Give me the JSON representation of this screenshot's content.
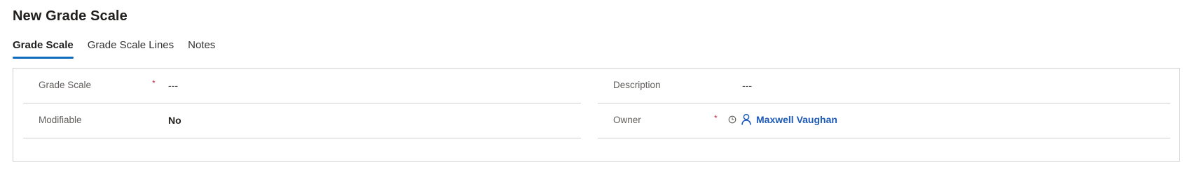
{
  "page": {
    "title": "New Grade Scale"
  },
  "tabs": [
    {
      "label": "Grade Scale",
      "active": true
    },
    {
      "label": "Grade Scale Lines",
      "active": false
    },
    {
      "label": "Notes",
      "active": false
    }
  ],
  "form": {
    "left": [
      {
        "label": "Grade Scale",
        "required": true,
        "required_mark": "*",
        "value": "---"
      },
      {
        "label": "Modifiable",
        "required": false,
        "value": "No"
      }
    ],
    "right": [
      {
        "label": "Description",
        "required": false,
        "value": "---"
      },
      {
        "label": "Owner",
        "required": true,
        "required_mark": "*",
        "value": "Maxwell Vaughan",
        "icons": [
          "clock-icon",
          "person-icon"
        ]
      }
    ]
  },
  "colors": {
    "accent": "#0f6cbd",
    "link": "#1e5bb8",
    "required": "#c4314b",
    "border": "#d2d0ce"
  }
}
